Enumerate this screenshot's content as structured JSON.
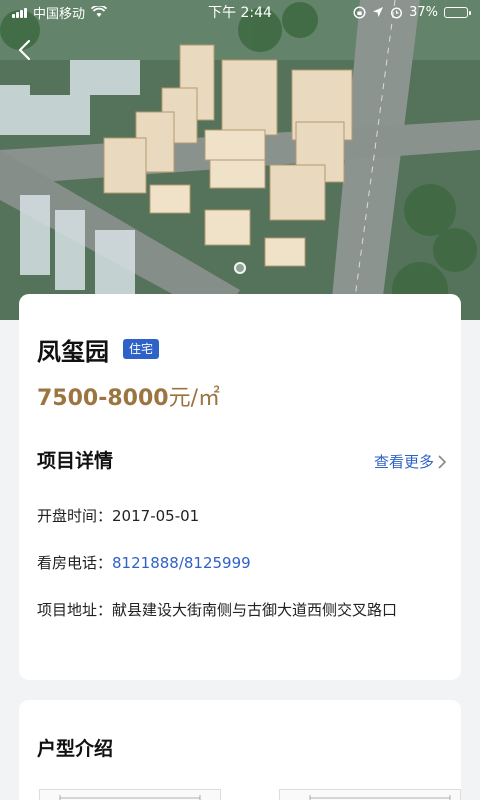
{
  "status_bar": {
    "carrier": "中国移动",
    "time": "下午 2:44",
    "battery": "37%",
    "battery_level": 0.37
  },
  "project": {
    "name": "凤玺园",
    "type_tag": "住宅",
    "price_range": "7500-8000",
    "price_unit": "元/㎡"
  },
  "details": {
    "section_title": "项目详情",
    "more_label": "查看更多",
    "open_date_label": "开盘时间：",
    "open_date": "2017-05-01",
    "phone_label": "看房电话：",
    "phone": "8121888/8125999",
    "address_label": "项目地址：",
    "address": "献县建设大街南侧与古御大道西侧交叉路口"
  },
  "floor_plans": {
    "section_title": "户型介绍"
  },
  "icons": {
    "back": "chevron-left-icon",
    "more": "chevron-right-icon",
    "wifi": "wifi-icon",
    "signal": "signal-icon",
    "battery": "battery-icon"
  },
  "colors": {
    "accent_blue": "#2f62c8",
    "price_gold": "#9b7440",
    "page_bg": "#f2f3f5"
  }
}
